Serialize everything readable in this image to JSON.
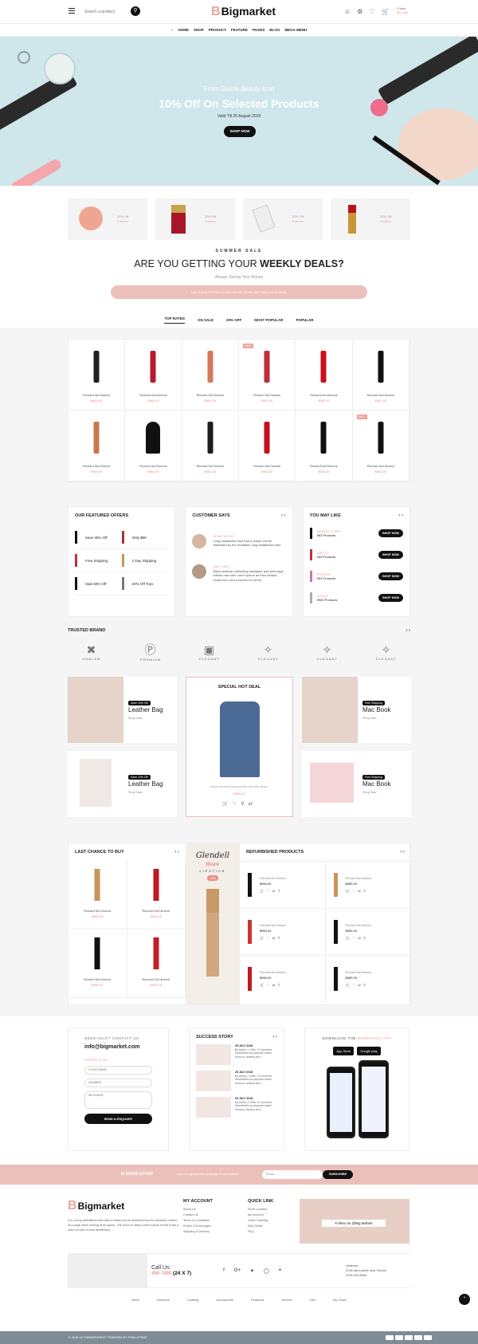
{
  "header": {
    "search_placeholder": "Search a product",
    "logo": "Bigmarket",
    "logo_mark": "B",
    "cart_items": "2 Item",
    "cart_label": "My Cart"
  },
  "nav": [
    "HOME",
    "SHOP",
    "PRODUCT",
    "FEATURE",
    "PAGES",
    "BLOG",
    "MEGA MENU"
  ],
  "hero": {
    "line1": "From Globle Beauty Icon",
    "line2": "10% Off On Selected Products",
    "line3": "Valid Till 25 August 2019",
    "button": "SHOP NOW"
  },
  "promos": [
    {
      "off": "20% Off",
      "label": "Fashion"
    },
    {
      "off": "20% Off",
      "label": "Fashion"
    },
    {
      "off": "20% Off",
      "label": "Fashion"
    },
    {
      "off": "20% Off",
      "label": "Fashion"
    }
  ],
  "sale": {
    "sub": "SUMMER SALE",
    "heading_pre": "ARE YOU GETTING YOUR",
    "heading_bold": "WEEKLY DEALS?",
    "tag": "Always Saving Your Money",
    "bar": "USE YOUR PROMO CODE AND BE SURE GETTING YOUR DEAL"
  },
  "tabs": [
    "TOP RATED",
    "ON SALE",
    "20% OFF",
    "MOST POPULAR",
    "POPULAR"
  ],
  "products": [
    {
      "name": "Richard McClintock",
      "price": "$963.00"
    },
    {
      "name": "Richard McClintock",
      "price": "$963.00"
    },
    {
      "name": "Richard McClintock",
      "price": "$963.00"
    },
    {
      "name": "Richard McClintock",
      "price": "$963.00",
      "badge": "SALE"
    },
    {
      "name": "Richard McClintock",
      "price": "$963.00"
    },
    {
      "name": "Richard McClintock",
      "price": "$963.00"
    },
    {
      "name": "Richard McClintock",
      "price": "$963.00"
    },
    {
      "name": "Richard McClintock",
      "price": "$963.00"
    },
    {
      "name": "Richard McClintock",
      "price": "$963.00"
    },
    {
      "name": "Richard McClintock",
      "price": "$963.00"
    },
    {
      "name": "Richard McClintock",
      "price": "$963.00"
    },
    {
      "name": "Richard McClintock",
      "price": "$963.00",
      "badge": "SALE"
    }
  ],
  "featured": {
    "title": "OUR FEATURED OFFERS",
    "items": [
      "Save 30% Off",
      "Only $99",
      "Free Shipping",
      "2 Day Shipping",
      "Sale 60% Off",
      "20% Off Toys"
    ]
  },
  "customer": {
    "title": "CUSTOMER SAYS",
    "reviews": [
      {
        "name": "SHARI NICHS",
        "text": "Long established fact that a reader will be distracted by the readable Long established fact."
      },
      {
        "name": "LAILI URES",
        "text": "Many desktop publishing packages and web page editors now use Lorem Ipsum as their default model text, and a search for lorem."
      }
    ]
  },
  "youmaylike": {
    "title": "YOU MAY LIKE",
    "items": [
      {
        "name": "MEMORY CARD",
        "count": "963 Products"
      },
      {
        "name": "WATCH",
        "count": "283 Products"
      },
      {
        "name": "PRINTER",
        "count": "953 Products"
      },
      {
        "name": "BOOKS",
        "count": "9963 Products"
      }
    ],
    "button": "SHOP NOW"
  },
  "brands": {
    "title": "TRUSTED BRAND",
    "names": [
      "EMBLEM",
      "PREMIUM",
      "ELEGANT",
      "ELEGANT",
      "ELEGANT",
      "ELEGANT"
    ]
  },
  "banners": {
    "tag": "Save 10% Off",
    "tag2": "Free Shipping",
    "b1": "Leather Bag",
    "b2": "Mac Book",
    "b3": "Leather Bag",
    "b4": "Mac Book",
    "shop": "Shop Now",
    "hot_title": "SPECIAL HOT DEAL",
    "hot_desc": "Ibicus nemrets face earliest over the years.",
    "hot_price": "$963.00"
  },
  "lastchance": {
    "title": "LAST CHANCE TO BUY",
    "items": [
      {
        "name": "Richard McClintock",
        "price": "$963.00"
      },
      {
        "name": "Richard McClintock",
        "price": "$963.00"
      },
      {
        "name": "Richard McClintock",
        "price": "$963.00"
      },
      {
        "name": "Richard McClintock",
        "price": "$963.00"
      }
    ]
  },
  "glendell": {
    "brand": "Glendell",
    "sub": "Block",
    "line": "LIPSTICK",
    "off": "10%"
  },
  "refurb": {
    "title": "REFURBISHED PRODUCTS",
    "items": [
      {
        "name": "Richard McClintock",
        "price": "$963.00"
      },
      {
        "name": "Richard McClintock",
        "price": "$963.00"
      },
      {
        "name": "Richard McClintock",
        "price": "$963.00"
      },
      {
        "name": "Richard McClintock",
        "price": "$963.00"
      },
      {
        "name": "Richard McClintock",
        "price": "$963.00"
      },
      {
        "name": "Richard McClintock",
        "price": "$963.00"
      }
    ]
  },
  "contact": {
    "need": "NEED HELP? CONTACT US",
    "email": "info@bigmarket.com",
    "contact_us": "CONTACT US",
    "name_ph": "YOUR NAME",
    "number_ph": "NUMBER",
    "message_ph": "MESSAGE",
    "button": "SEND A ENQUARY"
  },
  "story": {
    "title": "SUCCESS STORY",
    "items": [
      {
        "date": "25 JULY 2018",
        "meta": "By Admin, 4 Hits, 0 Comment",
        "text": "Sometimes on purpose acted humour, dummy text."
      },
      {
        "date": "25 JULY 2018",
        "meta": "By Admin, 4 Hits, 0 Comment",
        "text": "Sometimes on purpose acted humour, dummy text."
      },
      {
        "date": "25 JULY 2018",
        "meta": "By Admin, 4 Hits, 0 Comment",
        "text": "Sometimes on purpose acted humour, dummy text."
      }
    ]
  },
  "app": {
    "title_pre": "DOWNLOAD THE",
    "title_brand": "BIGMARKET APP",
    "appstore": "App Store",
    "googleplay": "Google play"
  },
  "newsletter": {
    "label": "NEWSLETTER",
    "text": "If you are going to use a passage of Lorem Ipsum.",
    "placeholder": "Email...",
    "button": "SUBSCRIBE"
  },
  "footer": {
    "about": "It is a long established fact that a reader will be distracted by the readable content of a page when looking at its layout. The point of using Lorem Ipsum is that it has a more-or-less normal distribution",
    "account_title": "MY ACCOUNT",
    "account": [
      "About Us",
      "Contact Us",
      "Terms & Conditions",
      "Return & Exchanges",
      "Shipping & Delivery"
    ],
    "quick_title": "QUICK LINK",
    "quick": [
      "Store Location",
      "My Account",
      "Order Tracking",
      "Size Guide",
      "FAQ"
    ],
    "insta": "Follow Us @Big Market",
    "callus": "Call Us:",
    "phone_pre": "456-7890",
    "phone_hours": "(24 X 7)",
    "address_label": "Address:",
    "address1": "B-56 big market near School",
    "address2": "USA 653-8964",
    "links": [
      "Mens",
      "Womens",
      "Clothing",
      "Accessories",
      "Featured",
      "Service",
      "Cart",
      "My Order"
    ],
    "copyright": "© 2018 19 THEMEFOREST POWERED BY PIXELSTRAP"
  }
}
